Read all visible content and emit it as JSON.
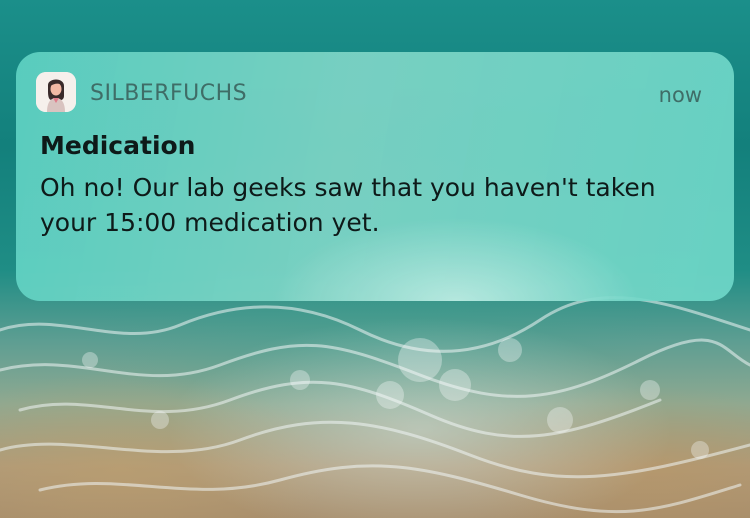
{
  "wallpaper": {
    "description_icon": "ocean-waves-wallpaper"
  },
  "notification": {
    "app_icon": "woman-avatar-icon",
    "app_name": "SILBERFUCHS",
    "timestamp": "now",
    "title": "Medication",
    "message": "Oh no! Our lab geeks saw that you haven't taken your 15:00 medication yet."
  },
  "colors": {
    "card_bg": "#70d6c6",
    "text_primary": "#0e1a19",
    "text_secondary": "#3f6d67"
  }
}
